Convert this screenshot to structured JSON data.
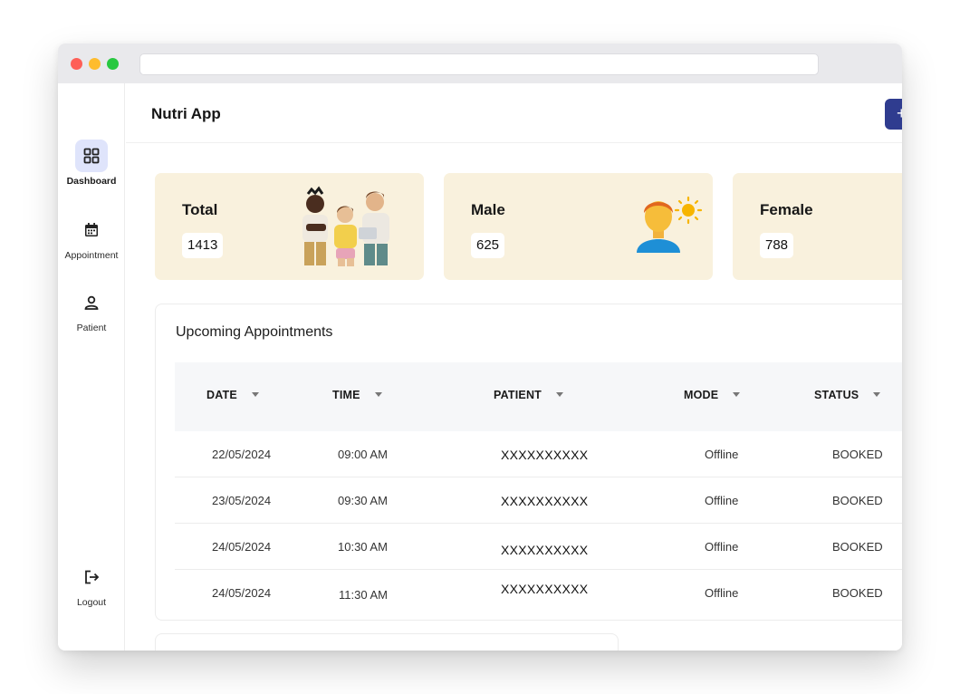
{
  "app": {
    "title": "Nutri App",
    "top_action_label": "+"
  },
  "sidebar": {
    "items": [
      {
        "label": "Dashboard",
        "icon": "grid-icon",
        "active": true
      },
      {
        "label": "Appointment",
        "icon": "calendar-icon",
        "active": false
      },
      {
        "label": "Patient",
        "icon": "user-icon",
        "active": false
      }
    ],
    "logout": {
      "label": "Logout",
      "icon": "logout-icon"
    }
  },
  "stats": [
    {
      "title": "Total",
      "value": "1413",
      "icon": "group-people-icon"
    },
    {
      "title": "Male",
      "value": "625",
      "icon": "male-person-icon"
    },
    {
      "title": "Female",
      "value": "788",
      "icon": "female-person-icon"
    }
  ],
  "appointments": {
    "title": "Upcoming Appointments",
    "columns": [
      "DATE",
      "TIME",
      "PATIENT",
      "MODE",
      "STATUS"
    ],
    "rows": [
      {
        "date": "22/05/2024",
        "time": "09:00 AM",
        "patient": "XXXXXXXXXX",
        "mode": "Offline",
        "status": "BOOKED"
      },
      {
        "date": "23/05/2024",
        "time": "09:30 AM",
        "patient": "XXXXXXXXXX",
        "mode": "Offline",
        "status": "BOOKED"
      },
      {
        "date": "24/05/2024",
        "time": "10:30 AM",
        "patient": "XXXXXXXXXX",
        "mode": "Offline",
        "status": "BOOKED"
      },
      {
        "date": "24/05/2024",
        "time": "11:30 AM",
        "patient": "XXXXXXXXXX",
        "mode": "Offline",
        "status": "BOOKED"
      }
    ]
  },
  "colors": {
    "accent": "#2f3c8f",
    "card_bg": "#f9f1dd",
    "active_nav_bg": "#dfe4fb"
  }
}
